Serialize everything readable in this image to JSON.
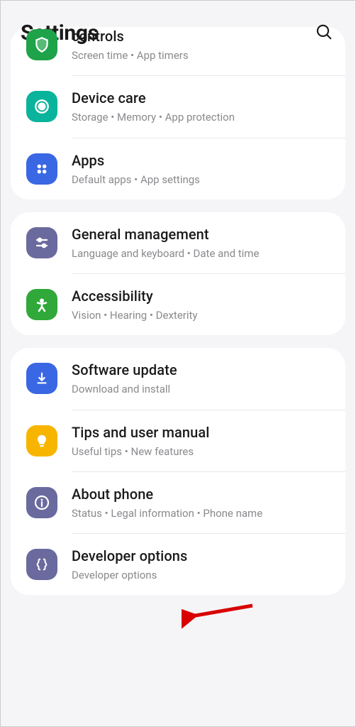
{
  "header": {
    "title": "Settings"
  },
  "groups": [
    {
      "id": "g1",
      "partial": true,
      "items": [
        {
          "id": "controls",
          "title": "controls",
          "subtitle": "Screen time  •  App timers",
          "icon": "shield-icon",
          "color": "ic-green1"
        },
        {
          "id": "device-care",
          "title": "Device care",
          "subtitle": "Storage  •  Memory  •  App protection",
          "icon": "target-icon",
          "color": "ic-teal"
        },
        {
          "id": "apps",
          "title": "Apps",
          "subtitle": "Default apps  •  App settings",
          "icon": "grid-icon",
          "color": "ic-blue"
        }
      ]
    },
    {
      "id": "g2",
      "items": [
        {
          "id": "general-management",
          "title": "General management",
          "subtitle": "Language and keyboard  •  Date and time",
          "icon": "sliders-icon",
          "color": "ic-purple"
        },
        {
          "id": "accessibility",
          "title": "Accessibility",
          "subtitle": "Vision  •  Hearing  •  Dexterity",
          "icon": "person-icon",
          "color": "ic-green2"
        }
      ]
    },
    {
      "id": "g3",
      "items": [
        {
          "id": "software-update",
          "title": "Software update",
          "subtitle": "Download and install",
          "icon": "download-icon",
          "color": "ic-blue2"
        },
        {
          "id": "tips",
          "title": "Tips and user manual",
          "subtitle": "Useful tips  •  New features",
          "icon": "bulb-icon",
          "color": "ic-yellow"
        },
        {
          "id": "about-phone",
          "title": "About phone",
          "subtitle": "Status  •  Legal information  •  Phone name",
          "icon": "info-icon",
          "color": "ic-purple2"
        },
        {
          "id": "developer-options",
          "title": "Developer options",
          "subtitle": "Developer options",
          "icon": "braces-icon",
          "color": "ic-grey"
        }
      ]
    }
  ],
  "annotation": {
    "target": "about-phone"
  }
}
